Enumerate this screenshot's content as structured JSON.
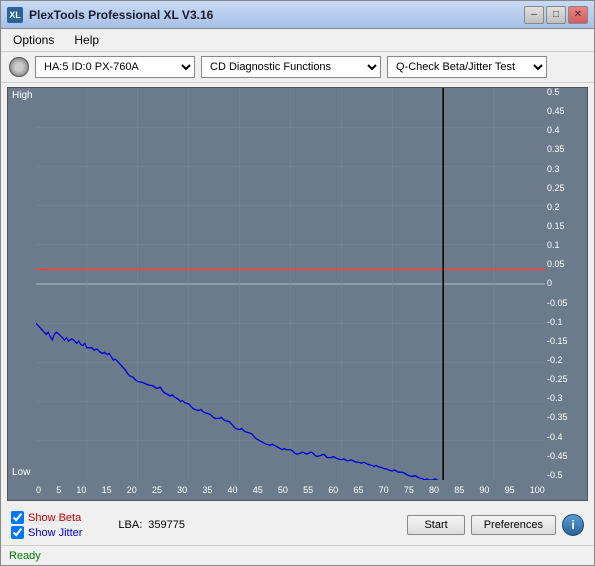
{
  "window": {
    "title": "PlexTools Professional XL V3.16",
    "icon": "XL"
  },
  "titlebar": {
    "minimize": "–",
    "maximize": "□",
    "close": "✕"
  },
  "menu": {
    "items": [
      "Options",
      "Help"
    ]
  },
  "toolbar": {
    "drive": "HA:5 ID:0  PX-760A",
    "function": "CD Diagnostic Functions",
    "test": "Q-Check Beta/Jitter Test"
  },
  "chart": {
    "y_high": "High",
    "y_low": "Low",
    "y_ticks": [
      "0.5",
      "0.45",
      "0.4",
      "0.35",
      "0.3",
      "0.25",
      "0.2",
      "0.15",
      "0.1",
      "0.05",
      "0",
      "-0.05",
      "-0.1",
      "-0.15",
      "-0.2",
      "-0.25",
      "-0.3",
      "-0.35",
      "-0.4",
      "-0.45",
      "-0.5"
    ],
    "x_ticks": [
      "0",
      "5",
      "10",
      "15",
      "20",
      "25",
      "30",
      "35",
      "40",
      "45",
      "50",
      "55",
      "60",
      "65",
      "70",
      "75",
      "80",
      "85",
      "90",
      "95",
      "100"
    ]
  },
  "controls": {
    "show_beta": "Show Beta",
    "show_jitter": "Show Jitter",
    "lba_label": "LBA:",
    "lba_value": "359775"
  },
  "buttons": {
    "start": "Start",
    "preferences": "Preferences",
    "info": "i"
  },
  "status": {
    "text": "Ready"
  },
  "colors": {
    "beta_line": "#ff0000",
    "jitter_line": "#0000ff",
    "grid_bg": "#6b7b8b",
    "grid_line": "#8a9aaa"
  }
}
